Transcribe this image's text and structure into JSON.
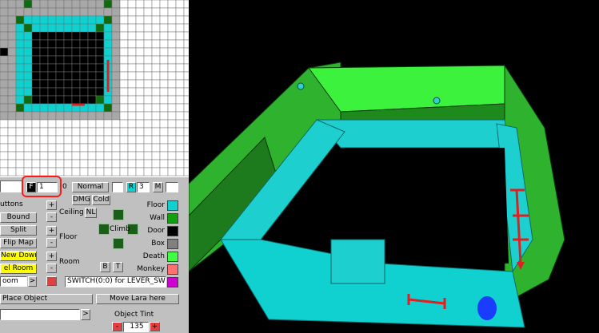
{
  "colors": {
    "wall_cyan": "#1ecfcf",
    "floor_cyan": "#10d0d0",
    "green": "#2fb32f",
    "dark_green": "#0f6a0f",
    "bright_green": "#3cf23c",
    "highlight_red": "#ff1a1a",
    "lever_red": "#e02020",
    "marker_blue": "#1a3cff"
  },
  "toolbar": {
    "flip_button": "F",
    "room_number_value": "1",
    "counter_label": "0",
    "normal_button": "Normal",
    "room_toggle": "R",
    "room_toggle_value": "3",
    "m_button": "M",
    "dmg_button": "DMG",
    "cold_button": "Cold",
    "nl_button": "NL"
  },
  "left_buttons": {
    "heading": "uttons",
    "bound": "Bound",
    "split": "Split",
    "flip_map": "Flip Map",
    "new_down": "New Down",
    "sel_room": "el Room",
    "room_dropdown": "oom",
    "room_dropdown_arrow": ">"
  },
  "section_labels": {
    "ceiling": "Ceiling",
    "floor": "Floor",
    "room": "Room",
    "climb": "Climb",
    "b_button": "B",
    "t_button": "T"
  },
  "steppers": {
    "plus": "+",
    "minus": "-"
  },
  "legend": [
    {
      "label": "Floor",
      "color": "#10d0d0"
    },
    {
      "label": "Wall",
      "color": "#10a010"
    },
    {
      "label": "Door",
      "color": "#000000"
    },
    {
      "label": "Box",
      "color": "#808080"
    },
    {
      "label": "Death",
      "color": "#40ff40"
    },
    {
      "label": "Monkey",
      "color": "#ff7070"
    },
    {
      "label": "",
      "color": "#d000d0"
    }
  ],
  "trigger_field": "SWITCH(0:0) for LEVER_SW",
  "bottom": {
    "place_object": "Place Object",
    "move_lara": "Move Lara here",
    "object_tint_label": "Object Tint",
    "tint_value": "135",
    "dropdown_arrow": ">",
    "minus": "-",
    "plus": "+"
  }
}
